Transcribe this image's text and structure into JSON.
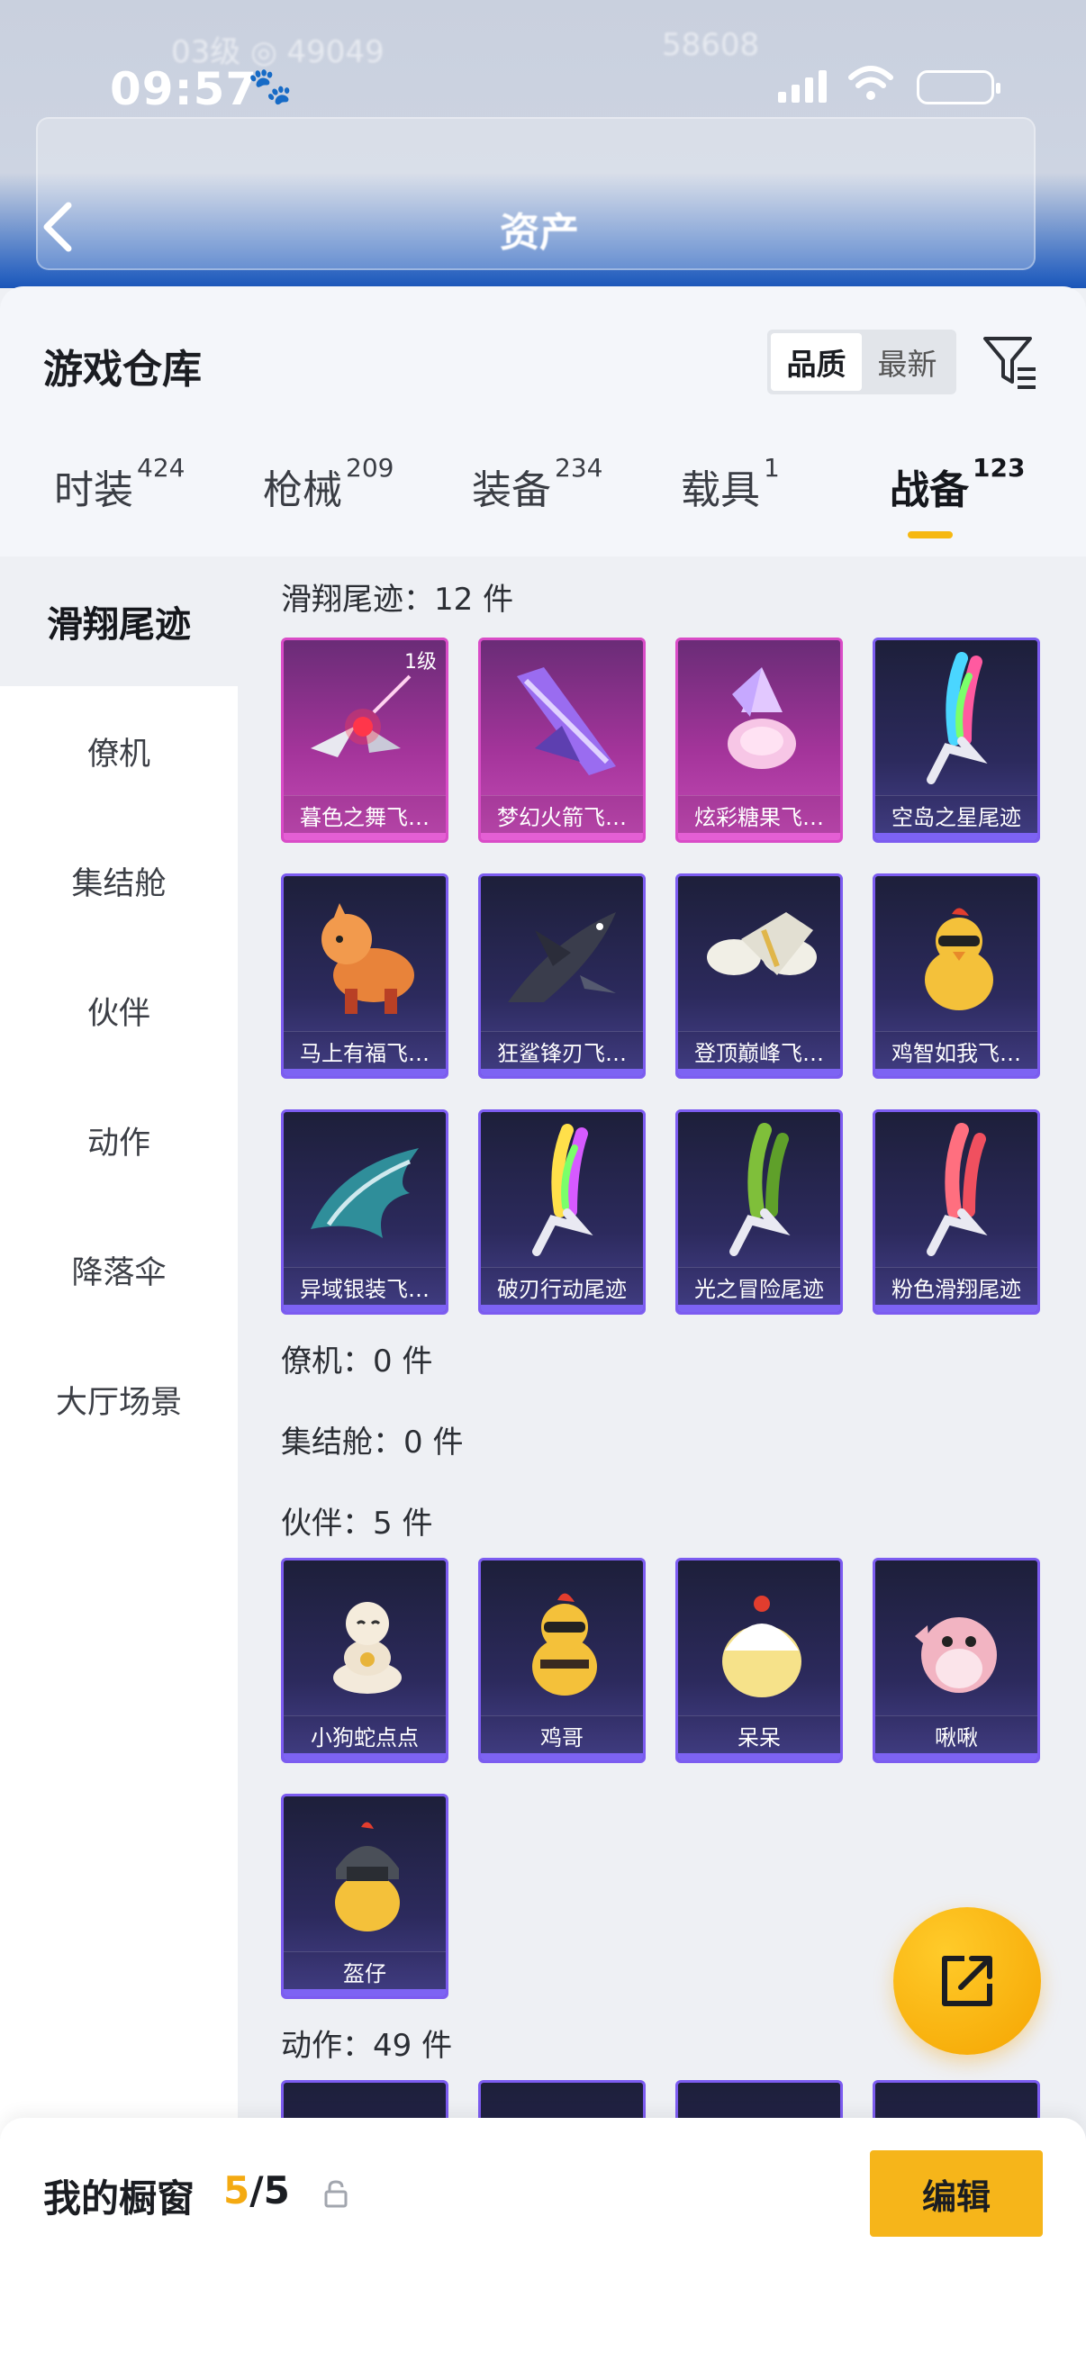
{
  "status_bar": {
    "time": "09:57"
  },
  "header": {
    "title": "资产"
  },
  "sheet": {
    "title": "游戏仓库",
    "sort_options": [
      "品质",
      "最新"
    ],
    "active_sort": "品质"
  },
  "tabs": [
    {
      "label": "时装",
      "count": "424"
    },
    {
      "label": "枪械",
      "count": "209"
    },
    {
      "label": "装备",
      "count": "234"
    },
    {
      "label": "载具",
      "count": "1"
    },
    {
      "label": "战备",
      "count": "123",
      "active": true
    }
  ],
  "sidebar": [
    "滑翔尾迹",
    "僚机",
    "集结舱",
    "伙伴",
    "动作",
    "降落伞",
    "大厅场景"
  ],
  "sections": {
    "glide_trail": {
      "title": "滑翔尾迹：12 件",
      "items": [
        {
          "name": "暮色之舞飞…",
          "level": "1级",
          "rarity": "pink",
          "icon": "drone-star-icon"
        },
        {
          "name": "梦幻火箭飞…",
          "rarity": "pink",
          "icon": "rocket-wing-icon"
        },
        {
          "name": "炫彩糖果飞…",
          "rarity": "pink",
          "icon": "candy-icon"
        },
        {
          "name": "空岛之星尾迹",
          "rarity": "blue",
          "icon": "rainbow-smoke-icon"
        },
        {
          "name": "马上有福飞…",
          "rarity": "blue",
          "icon": "horse-icon"
        },
        {
          "name": "狂鲨锋刃飞…",
          "rarity": "blue",
          "icon": "shark-icon"
        },
        {
          "name": "登顶巅峰飞…",
          "rarity": "blue",
          "icon": "jet-icon"
        },
        {
          "name": "鸡智如我飞…",
          "rarity": "blue",
          "icon": "chicken-icon"
        },
        {
          "name": "异域银装飞…",
          "rarity": "blue",
          "icon": "dragon-wing-icon"
        },
        {
          "name": "破刃行动尾迹",
          "rarity": "blue",
          "icon": "rainbow-smoke-icon"
        },
        {
          "name": "光之冒险尾迹",
          "rarity": "blue",
          "icon": "green-smoke-icon"
        },
        {
          "name": "粉色滑翔尾迹",
          "rarity": "blue",
          "icon": "pink-smoke-icon"
        }
      ]
    },
    "wingman": {
      "title": "僚机：0 件"
    },
    "pod": {
      "title": "集结舱：0 件"
    },
    "partner": {
      "title": "伙伴：5 件",
      "items": [
        {
          "name": "小狗蛇点点",
          "rarity": "blue",
          "icon": "snake-icon"
        },
        {
          "name": "鸡哥",
          "rarity": "blue",
          "icon": "chicken-sunglasses-icon"
        },
        {
          "name": "呆呆",
          "rarity": "blue",
          "icon": "chick-icon"
        },
        {
          "name": "啾啾",
          "rarity": "blue",
          "icon": "pink-bird-icon"
        },
        {
          "name": "盔仔",
          "rarity": "blue",
          "icon": "helmet-chick-icon"
        }
      ]
    },
    "emote": {
      "title": "动作：49 件"
    }
  },
  "bottom_bar": {
    "title": "我的橱窗",
    "current": "5",
    "total": "/5",
    "edit_label": "编辑"
  },
  "colors": {
    "accent": "#f6b51a",
    "pink_rarity": "#c64bb6",
    "blue_rarity": "#2c2a5d"
  }
}
